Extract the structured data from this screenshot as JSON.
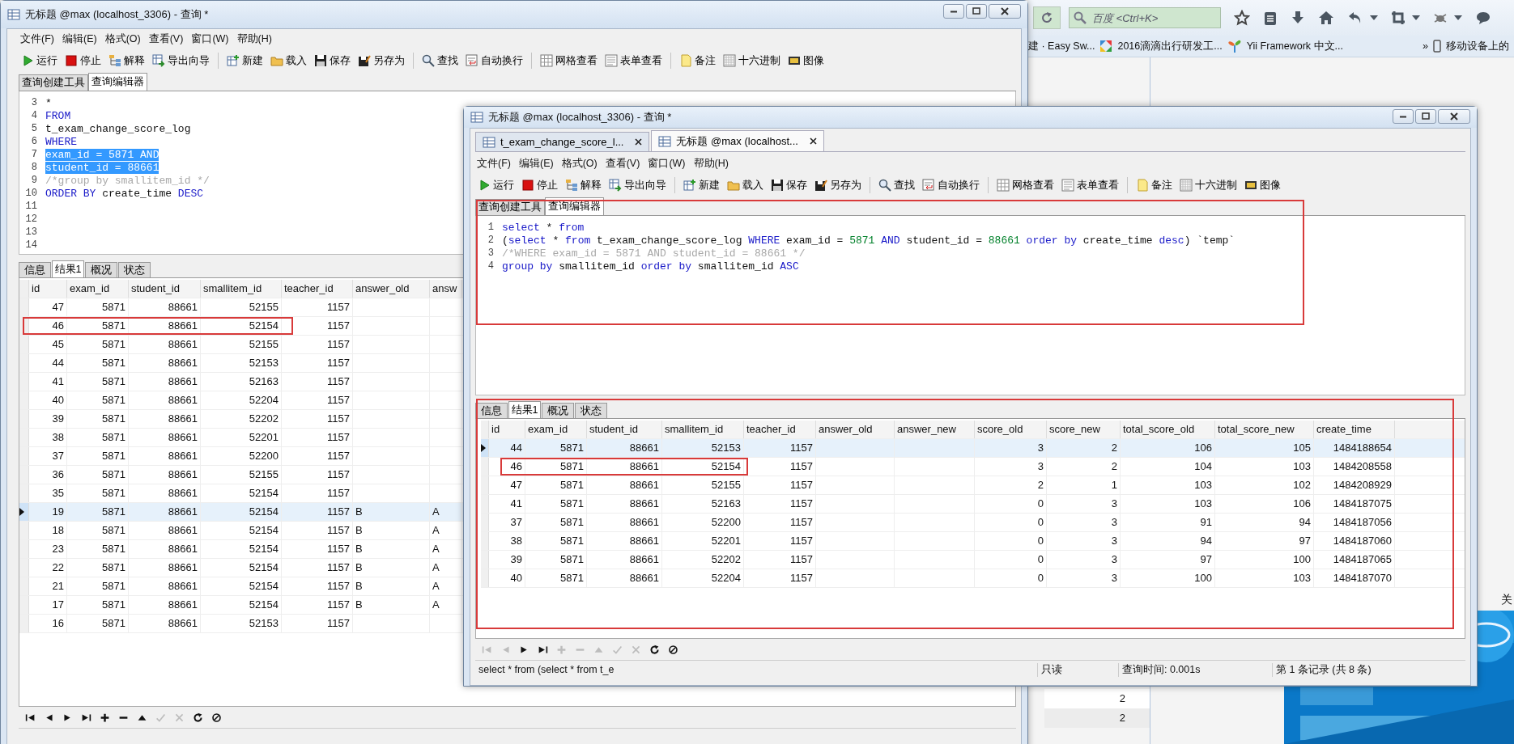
{
  "browser": {
    "search": {
      "placeholder": "百度 <Ctrl+K>"
    },
    "bookmarks": [
      {
        "label": "建 · Easy Sw..."
      },
      {
        "label": "2016滴滴出行研发工..."
      },
      {
        "label": "Yii Framework 中文..."
      }
    ],
    "overflow": "»",
    "mobile_bookmark": "移动设备上的",
    "page_cells": [
      "2",
      "2"
    ],
    "edge_text": "关",
    "ad": {
      "kind": "picture"
    }
  },
  "windows": [
    {
      "title": "无标题 @max (localhost_3306) - 查询 *",
      "menu": [
        "文件(F)",
        "编辑(E)",
        "格式(O)",
        "查看(V)",
        "窗口(W)",
        "帮助(H)"
      ],
      "toolbar": [
        {
          "label": "运行"
        },
        {
          "label": "停止"
        },
        {
          "label": "解释"
        },
        {
          "label": "导出向导"
        },
        {
          "label": "新建"
        },
        {
          "label": "载入"
        },
        {
          "label": "保存"
        },
        {
          "label": "另存为"
        },
        {
          "label": "查找"
        },
        {
          "label": "自动换行"
        },
        {
          "label": "网格查看"
        },
        {
          "label": "表单查看"
        },
        {
          "label": "备注"
        },
        {
          "label": "十六进制"
        },
        {
          "label": "图像"
        }
      ],
      "editor_tabs": [
        {
          "label": "查询创建工具",
          "selected": false
        },
        {
          "label": "查询编辑器",
          "selected": true
        }
      ],
      "editor": {
        "lines": [
          {
            "number": "3",
            "tokens": [
              {
                "text": "*",
                "kind": "plain"
              }
            ]
          },
          {
            "number": "4",
            "tokens": [
              {
                "text": "FROM",
                "kind": "kw"
              }
            ]
          },
          {
            "number": "5",
            "tokens": [
              {
                "text": "t_exam_change_score_log",
                "kind": "plain"
              }
            ]
          },
          {
            "number": "6",
            "tokens": [
              {
                "text": "WHERE",
                "kind": "kw"
              }
            ]
          },
          {
            "number": "7",
            "selected": true,
            "tokens": [
              {
                "text": "exam_id = ",
                "kind": "plain"
              },
              {
                "text": "5871",
                "kind": "num"
              },
              {
                "text": " AND",
                "kind": "kw"
              }
            ]
          },
          {
            "number": "8",
            "selected": true,
            "tokens": [
              {
                "text": "student_id = ",
                "kind": "plain"
              },
              {
                "text": "88661",
                "kind": "num"
              }
            ]
          },
          {
            "number": "9",
            "tokens": [
              {
                "text": "/*group by smallitem_id */",
                "kind": "comment"
              }
            ]
          },
          {
            "number": "10",
            "tokens": [
              {
                "text": "ORDER BY",
                "kind": "kw"
              },
              {
                "text": " create_time ",
                "kind": "plain"
              },
              {
                "text": "DESC",
                "kind": "kw"
              }
            ]
          },
          {
            "number": "11"
          },
          {
            "number": "12"
          },
          {
            "number": "13"
          },
          {
            "number": "14"
          }
        ]
      },
      "result_tabs": [
        {
          "label": "信息",
          "selected": false
        },
        {
          "label": "结果1",
          "selected": true
        },
        {
          "label": "概况",
          "selected": false
        },
        {
          "label": "状态",
          "selected": false
        }
      ],
      "table": {
        "columns": [
          "id",
          "exam_id",
          "student_id",
          "smallitem_id",
          "teacher_id",
          "answer_old",
          "answ"
        ],
        "rows": [
          {
            "cells": [
              "47",
              "5871",
              "88661",
              "52155",
              "1157",
              null,
              null
            ],
            "selected": false
          },
          {
            "cells": [
              "46",
              "5871",
              "88661",
              "52154",
              "1157",
              null,
              null
            ],
            "selected": false,
            "outlined": true
          },
          {
            "cells": [
              "45",
              "5871",
              "88661",
              "52155",
              "1157",
              null,
              null
            ],
            "selected": false
          },
          {
            "cells": [
              "44",
              "5871",
              "88661",
              "52153",
              "1157",
              null,
              null
            ],
            "selected": false
          },
          {
            "cells": [
              "41",
              "5871",
              "88661",
              "52163",
              "1157",
              null,
              null
            ],
            "selected": false
          },
          {
            "cells": [
              "40",
              "5871",
              "88661",
              "52204",
              "1157",
              null,
              null
            ],
            "selected": false
          },
          {
            "cells": [
              "39",
              "5871",
              "88661",
              "52202",
              "1157",
              null,
              null
            ],
            "selected": false
          },
          {
            "cells": [
              "38",
              "5871",
              "88661",
              "52201",
              "1157",
              null,
              null
            ],
            "selected": false
          },
          {
            "cells": [
              "37",
              "5871",
              "88661",
              "52200",
              "1157",
              null,
              null
            ],
            "selected": false
          },
          {
            "cells": [
              "36",
              "5871",
              "88661",
              "52155",
              "1157",
              null,
              null
            ],
            "selected": false
          },
          {
            "cells": [
              "35",
              "5871",
              "88661",
              "52154",
              "1157",
              null,
              null
            ],
            "selected": false
          },
          {
            "cells": [
              "19",
              "5871",
              "88661",
              "52154",
              "1157",
              "B",
              "A"
            ],
            "selected": true
          },
          {
            "cells": [
              "18",
              "5871",
              "88661",
              "52154",
              "1157",
              "B",
              "A"
            ],
            "selected": false
          },
          {
            "cells": [
              "23",
              "5871",
              "88661",
              "52154",
              "1157",
              "B",
              "A"
            ],
            "selected": false
          },
          {
            "cells": [
              "22",
              "5871",
              "88661",
              "52154",
              "1157",
              "B",
              "A"
            ],
            "selected": false
          },
          {
            "cells": [
              "21",
              "5871",
              "88661",
              "52154",
              "1157",
              "B",
              "A"
            ],
            "selected": false
          },
          {
            "cells": [
              "17",
              "5871",
              "88661",
              "52154",
              "1157",
              "B",
              "A"
            ],
            "selected": false
          },
          {
            "cells": [
              "16",
              "5871",
              "88661",
              "52153",
              "1157",
              null,
              null
            ],
            "selected": false
          }
        ]
      },
      "nav": [
        {
          "disabled": false
        },
        {
          "disabled": false
        },
        {
          "disabled": false
        },
        {
          "disabled": false
        },
        {
          "disabled": false
        },
        {
          "disabled": false
        },
        {
          "disabled": false
        },
        {
          "disabled": true
        },
        {
          "disabled": true
        },
        {
          "disabled": false
        },
        {
          "disabled": false
        }
      ]
    },
    {
      "title": "无标题 @max (localhost_3306) - 查询 *",
      "doc_tabs": [
        {
          "label": "t_exam_change_score_l...",
          "selected": false
        },
        {
          "label": "无标题 @max (localhost...",
          "selected": true
        }
      ],
      "menu": [
        "文件(F)",
        "编辑(E)",
        "格式(O)",
        "查看(V)",
        "窗口(W)",
        "帮助(H)"
      ],
      "toolbar": [
        {
          "label": "运行"
        },
        {
          "label": "停止"
        },
        {
          "label": "解释"
        },
        {
          "label": "导出向导"
        },
        {
          "label": "新建"
        },
        {
          "label": "载入"
        },
        {
          "label": "保存"
        },
        {
          "label": "另存为"
        },
        {
          "label": "查找"
        },
        {
          "label": "自动换行"
        },
        {
          "label": "网格查看"
        },
        {
          "label": "表单查看"
        },
        {
          "label": "备注"
        },
        {
          "label": "十六进制"
        },
        {
          "label": "图像"
        }
      ],
      "editor_tabs": [
        {
          "label": "查询创建工具",
          "selected": false
        },
        {
          "label": "查询编辑器",
          "selected": true
        }
      ],
      "editor": {
        "outlined": true,
        "lines": [
          {
            "number": "1",
            "tokens": [
              {
                "text": "select",
                "kind": "kw"
              },
              {
                "text": " * ",
                "kind": "plain"
              },
              {
                "text": "from",
                "kind": "kw"
              }
            ]
          },
          {
            "number": "2",
            "tokens": [
              {
                "text": "(",
                "kind": "plain"
              },
              {
                "text": "select",
                "kind": "kw"
              },
              {
                "text": " * ",
                "kind": "plain"
              },
              {
                "text": "from",
                "kind": "kw"
              },
              {
                "text": " t_exam_change_score_log ",
                "kind": "plain"
              },
              {
                "text": "WHERE",
                "kind": "kw"
              },
              {
                "text": " exam_id = ",
                "kind": "plain"
              },
              {
                "text": "5871",
                "kind": "num"
              },
              {
                "text": " AND",
                "kind": "kw"
              },
              {
                "text": " student_id = ",
                "kind": "plain"
              },
              {
                "text": "88661",
                "kind": "num"
              },
              {
                "text": " order by",
                "kind": "kw"
              },
              {
                "text": " create_time ",
                "kind": "plain"
              },
              {
                "text": "desc",
                "kind": "kw"
              },
              {
                "text": ") `temp`",
                "kind": "plain"
              }
            ]
          },
          {
            "number": "3",
            "tokens": [
              {
                "text": "/*WHERE exam_id = 5871 AND student_id = 88661 */",
                "kind": "comment"
              }
            ]
          },
          {
            "number": "4",
            "tokens": [
              {
                "text": "group by",
                "kind": "kw"
              },
              {
                "text": " smallitem_id ",
                "kind": "plain"
              },
              {
                "text": "order by",
                "kind": "kw"
              },
              {
                "text": " smallitem_id ",
                "kind": "plain"
              },
              {
                "text": "ASC",
                "kind": "kw"
              }
            ]
          }
        ]
      },
      "result_tabs": [
        {
          "label": "信息",
          "selected": false
        },
        {
          "label": "结果1",
          "selected": true
        },
        {
          "label": "概况",
          "selected": false
        },
        {
          "label": "状态",
          "selected": false
        }
      ],
      "results_outlined": true,
      "table": {
        "columns": [
          "id",
          "exam_id",
          "student_id",
          "smallitem_id",
          "teacher_id",
          "answer_old",
          "answer_new",
          "score_old",
          "score_new",
          "total_score_old",
          "total_score_new",
          "create_time"
        ],
        "rows": [
          {
            "cells": [
              "44",
              "5871",
              "88661",
              "52153",
              "1157",
              null,
              null,
              "3",
              "2",
              "106",
              "105",
              "1484188654"
            ],
            "selected": true
          },
          {
            "cells": [
              "46",
              "5871",
              "88661",
              "52154",
              "1157",
              null,
              null,
              "3",
              "2",
              "104",
              "103",
              "1484208558"
            ],
            "selected": false,
            "outlined": true
          },
          {
            "cells": [
              "47",
              "5871",
              "88661",
              "52155",
              "1157",
              null,
              null,
              "2",
              "1",
              "103",
              "102",
              "1484208929"
            ],
            "selected": false
          },
          {
            "cells": [
              "41",
              "5871",
              "88661",
              "52163",
              "1157",
              null,
              null,
              "0",
              "3",
              "103",
              "106",
              "1484187075"
            ],
            "selected": false
          },
          {
            "cells": [
              "37",
              "5871",
              "88661",
              "52200",
              "1157",
              null,
              null,
              "0",
              "3",
              "91",
              "94",
              "1484187056"
            ],
            "selected": false
          },
          {
            "cells": [
              "38",
              "5871",
              "88661",
              "52201",
              "1157",
              null,
              null,
              "0",
              "3",
              "94",
              "97",
              "1484187060"
            ],
            "selected": false
          },
          {
            "cells": [
              "39",
              "5871",
              "88661",
              "52202",
              "1157",
              null,
              null,
              "0",
              "3",
              "97",
              "100",
              "1484187065"
            ],
            "selected": false
          },
          {
            "cells": [
              "40",
              "5871",
              "88661",
              "52204",
              "1157",
              null,
              null,
              "0",
              "3",
              "100",
              "103",
              "1484187070"
            ],
            "selected": false
          }
        ]
      },
      "nav": [
        {
          "disabled": true
        },
        {
          "disabled": true
        },
        {
          "disabled": false
        },
        {
          "disabled": false
        },
        {
          "disabled": true
        },
        {
          "disabled": true
        },
        {
          "disabled": true
        },
        {
          "disabled": true
        },
        {
          "disabled": true
        },
        {
          "disabled": false
        },
        {
          "disabled": false
        }
      ],
      "status": [
        "select * from  (select * from t_e",
        "只读",
        "查询时间: 0.001s",
        "第 1 条记录 (共 8 条)"
      ]
    }
  ]
}
